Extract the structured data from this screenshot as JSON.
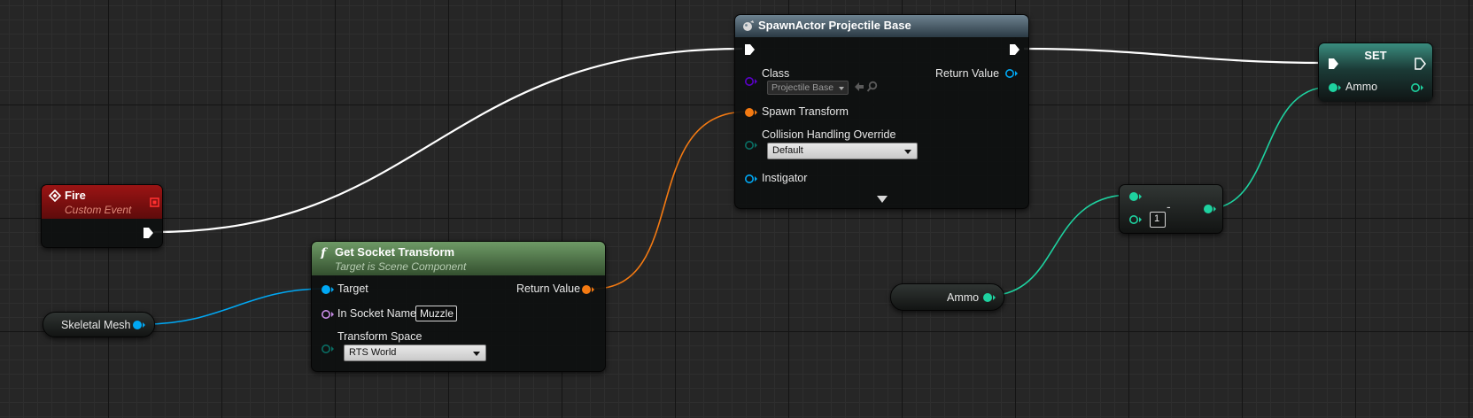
{
  "colors": {
    "exec": "#ffffff",
    "object": "#00a8f4",
    "transform": "#f47a12",
    "class": "#5a00c8",
    "name": "#c88ce6",
    "enum": "#0a6e64",
    "int": "#1ed2a0",
    "fire_header": "#8a0f0f",
    "function_header": "#4a6e45",
    "set_header": "#1e6c60"
  },
  "nodes": {
    "fire": {
      "title": "Fire",
      "subtitle": "Custom Event",
      "header_icon": "event-diamond-icon"
    },
    "spawn": {
      "title": "SpawnActor Projectile Base",
      "header_icon": "spawn-actor-icon",
      "class_label": "Class",
      "class_value": "Projectile Base",
      "return_label": "Return Value",
      "spawn_transform_label": "Spawn Transform",
      "collision_label": "Collision Handling Override",
      "collision_value": "Default",
      "instigator_label": "Instigator",
      "expand_icon": "expand-arrow-icon"
    },
    "socket": {
      "title": "Get Socket Transform",
      "subtitle": "Target is Scene Component",
      "header_icon": "function-icon",
      "target_label": "Target",
      "return_label": "Return Value",
      "socket_label": "In Socket Name",
      "socket_value": "Muzzle",
      "space_label": "Transform Space",
      "space_value": "RTS World"
    },
    "set": {
      "title": "SET",
      "ammo_label": "Ammo"
    },
    "skeletal": {
      "label": "Skeletal Mesh"
    },
    "ammo_get": {
      "label": "Ammo"
    },
    "subtract": {
      "op": "-",
      "value": "1"
    }
  }
}
